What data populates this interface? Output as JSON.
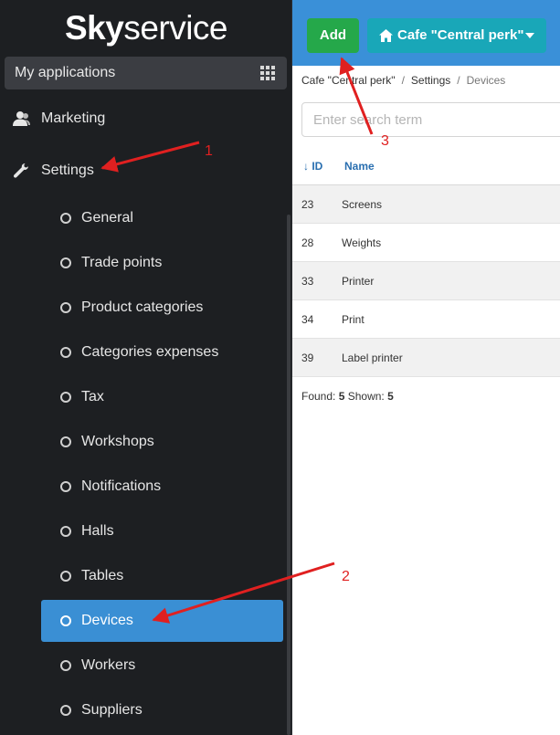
{
  "logo": {
    "bold": "Sky",
    "regular": "service"
  },
  "sidebar": {
    "my_apps_label": "My applications",
    "marketing_label": "Marketing",
    "settings_label": "Settings",
    "settings_items": [
      {
        "label": "General"
      },
      {
        "label": "Trade points"
      },
      {
        "label": "Product categories"
      },
      {
        "label": "Categories expenses"
      },
      {
        "label": "Tax"
      },
      {
        "label": "Workshops"
      },
      {
        "label": "Notifications"
      },
      {
        "label": "Halls"
      },
      {
        "label": "Tables"
      },
      {
        "label": "Devices",
        "active": true
      },
      {
        "label": "Workers"
      },
      {
        "label": "Suppliers"
      }
    ]
  },
  "toolbar": {
    "add_label": "Add",
    "place_label": "Cafe \"Central perk\""
  },
  "breadcrumb": {
    "items": [
      "Cafe \"Central perk\"",
      "Settings",
      "Devices"
    ]
  },
  "search": {
    "placeholder": "Enter search term",
    "value": ""
  },
  "table": {
    "columns": [
      "ID",
      "Name"
    ],
    "rows": [
      {
        "id": "23",
        "name": "Screens"
      },
      {
        "id": "28",
        "name": "Weights"
      },
      {
        "id": "33",
        "name": "Printer"
      },
      {
        "id": "34",
        "name": "Print"
      },
      {
        "id": "39",
        "name": "Label printer"
      }
    ]
  },
  "footer": {
    "found_label": "Found:",
    "found": "5",
    "shown_label": "Shown:",
    "shown": "5"
  },
  "annotations": {
    "n1": "1",
    "n2": "2",
    "n3": "3"
  },
  "colors": {
    "sidebar_bg": "#1d1f22",
    "topbar_bg": "#3a90d8",
    "add_button": "#25a84a",
    "place_button": "#19a7b8",
    "active_item": "#3a8fd4",
    "annotation": "#e02020"
  }
}
